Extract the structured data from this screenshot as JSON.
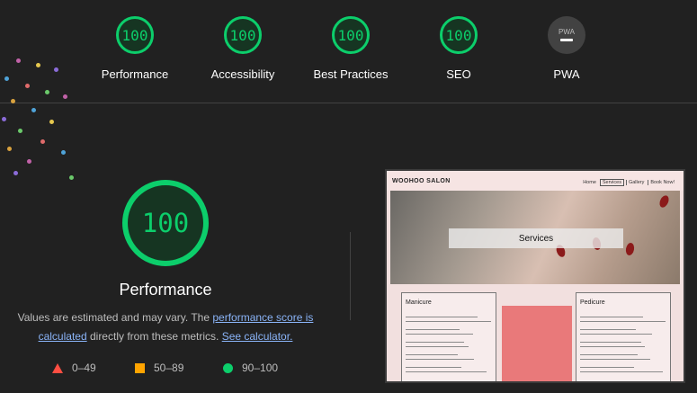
{
  "top_scores": [
    {
      "name": "Performance",
      "score": "100"
    },
    {
      "name": "Accessibility",
      "score": "100"
    },
    {
      "name": "Best Practices",
      "score": "100"
    },
    {
      "name": "SEO",
      "score": "100"
    },
    {
      "name": "PWA",
      "score": "",
      "badge_text": "PWA"
    }
  ],
  "main": {
    "score": "100",
    "title": "Performance",
    "desc_prefix": "Values are estimated and may vary. The ",
    "link_score": "performance score is calculated",
    "desc_middle": " directly from these metrics. ",
    "link_calculator": "See calculator."
  },
  "legend": [
    {
      "range": "0–49",
      "color": "#ff4e42",
      "shape": "triangle"
    },
    {
      "range": "50–89",
      "color": "#ffa400",
      "shape": "square"
    },
    {
      "range": "90–100",
      "color": "#0cce6b",
      "shape": "circle"
    }
  ],
  "screenshot": {
    "logo": "WOOHOO SALON",
    "nav": [
      "Home",
      "Services",
      "Gallery",
      "Book Now!"
    ],
    "banner": "Services",
    "cards": [
      "Manicure",
      "Pedicure"
    ]
  },
  "colors": {
    "pass": "#0cce6b",
    "background": "#212121",
    "link": "#8ab4f8"
  }
}
